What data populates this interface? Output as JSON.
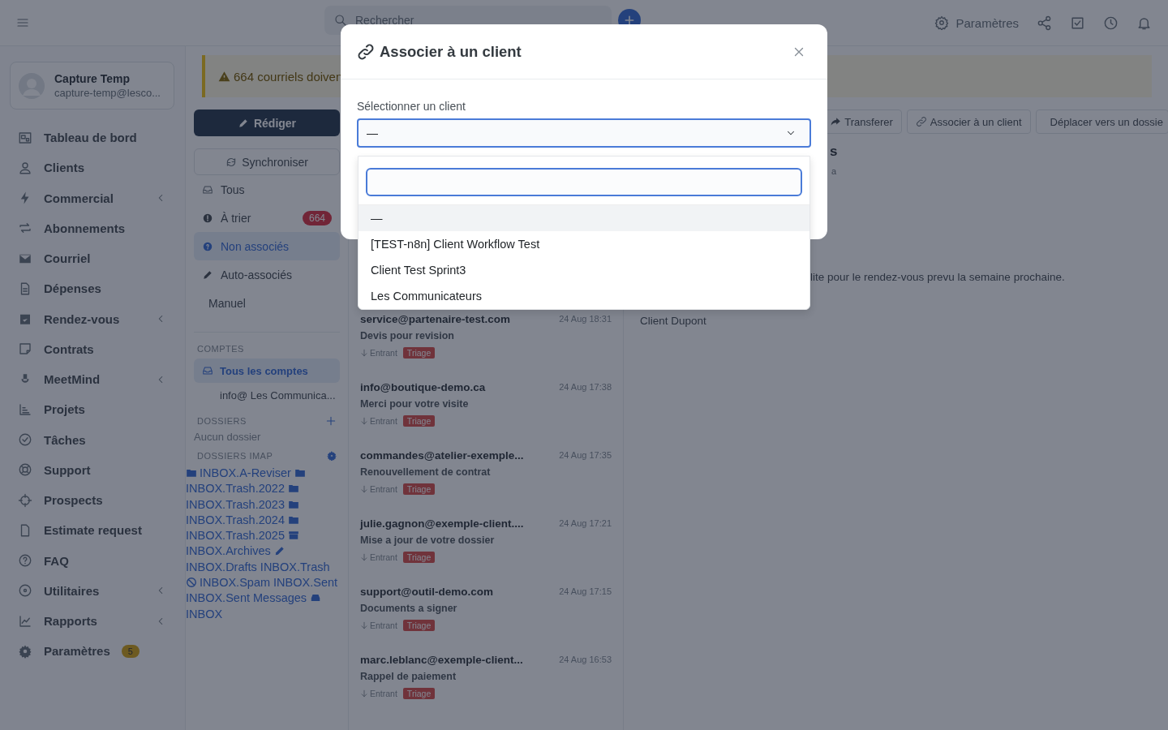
{
  "topbar": {
    "search": {
      "placeholder": "Rechercher"
    },
    "settings_label": "Paramètres"
  },
  "sidebar": {
    "user": {
      "name": "Capture Temp",
      "email": "capture-temp@lesco..."
    },
    "items": [
      {
        "label": "Tableau de bord",
        "expandable": false
      },
      {
        "label": "Clients",
        "expandable": false
      },
      {
        "label": "Commercial",
        "expandable": true
      },
      {
        "label": "Abonnements",
        "expandable": false
      },
      {
        "label": "Courriel",
        "expandable": false
      },
      {
        "label": "Dépenses",
        "expandable": false
      },
      {
        "label": "Rendez-vous",
        "expandable": true
      },
      {
        "label": "Contrats",
        "expandable": false
      },
      {
        "label": "MeetMind",
        "expandable": true
      },
      {
        "label": "Projets",
        "expandable": false
      },
      {
        "label": "Tâches",
        "expandable": false
      },
      {
        "label": "Support",
        "expandable": false
      },
      {
        "label": "Prospects",
        "expandable": false
      },
      {
        "label": "Estimate request",
        "expandable": false
      },
      {
        "label": "FAQ",
        "expandable": false
      },
      {
        "label": "Utilitaires",
        "expandable": true
      },
      {
        "label": "Rapports",
        "expandable": true
      },
      {
        "label": "Paramètres",
        "expandable": false,
        "badge": "5"
      }
    ]
  },
  "banner": {
    "text": "664 courriels doiven"
  },
  "mail_nav": {
    "compose": "Rédiger",
    "sync": "Synchroniser",
    "folders": [
      {
        "label": "Tous",
        "selected": false
      },
      {
        "label": "À trier",
        "selected": false,
        "badge": "664"
      },
      {
        "label": "Non associés",
        "selected": true
      },
      {
        "label": "Auto-associés",
        "selected": false
      },
      {
        "label": "Manuel",
        "selected": false
      }
    ],
    "accounts_heading": "COMPTES",
    "accounts": [
      {
        "label": "Tous les comptes",
        "selected": true
      },
      {
        "label": "info@ Les Communica...",
        "selected": false
      }
    ],
    "dossiers_heading": "DOSSIERS",
    "dossiers_empty": "Aucun dossier",
    "imap_heading": "DOSSIERS IMAP",
    "imap_folders": [
      {
        "name": "INBOX.A-Reviser",
        "kind": "folder"
      },
      {
        "name": "INBOX.Trash.2022",
        "kind": "folder"
      },
      {
        "name": "INBOX.Trash.2023",
        "kind": "folder"
      },
      {
        "name": "INBOX.Trash.2024",
        "kind": "folder"
      },
      {
        "name": "INBOX.Trash.2025",
        "kind": "folder"
      },
      {
        "name": "INBOX.Archives",
        "kind": "archive"
      },
      {
        "name": "INBOX.Drafts",
        "kind": "pencil"
      },
      {
        "name": "INBOX.Trash",
        "kind": "plain"
      },
      {
        "name": "INBOX.Spam",
        "kind": "ban"
      },
      {
        "name": "INBOX.Sent",
        "kind": "plain"
      },
      {
        "name": "INBOX.Sent Messages",
        "kind": "plain"
      },
      {
        "name": "INBOX",
        "kind": "inbox"
      }
    ]
  },
  "emails": [
    {
      "from": "service@partenaire-test.com",
      "date": "24 Aug 18:31",
      "subject": "Devis pour revision",
      "direction": "Entrant",
      "tag": "Triage"
    },
    {
      "from": "info@boutique-demo.ca",
      "date": "24 Aug 17:38",
      "subject": "Merci pour votre visite",
      "direction": "Entrant",
      "tag": "Triage"
    },
    {
      "from": "commandes@atelier-exemple...",
      "date": "24 Aug 17:35",
      "subject": "Renouvellement de contrat",
      "direction": "Entrant",
      "tag": "Triage"
    },
    {
      "from": "julie.gagnon@exemple-client....",
      "date": "24 Aug 17:21",
      "subject": "Mise a jour de votre dossier",
      "direction": "Entrant",
      "tag": "Triage"
    },
    {
      "from": "support@outil-demo.com",
      "date": "24 Aug 17:15",
      "subject": "Documents a signer",
      "direction": "Entrant",
      "tag": "Triage"
    },
    {
      "from": "marc.leblanc@exemple-client...",
      "date": "24 Aug 16:53",
      "subject": "Rappel de paiement",
      "direction": "Entrant",
      "tag": "Triage"
    }
  ],
  "detail": {
    "actions": [
      "Transferer",
      "Associer à un client",
      "Déplacer vers un dossie"
    ],
    "heading_fragment": "s",
    "meta_fragment": "a",
    "body_fragment": "lite pour le rendez-vous prevu la semaine prochaine.",
    "client": "Client Dupont"
  },
  "modal": {
    "title": "Associer à un client",
    "field_label": "Sélectionner un client",
    "value": "—",
    "options": [
      {
        "label": "—",
        "selected": true
      },
      {
        "label": "[TEST-n8n] Client Workflow Test",
        "selected": false
      },
      {
        "label": "Client Test Sprint3",
        "selected": false
      },
      {
        "label": "Les Communicateurs",
        "selected": false
      }
    ]
  }
}
